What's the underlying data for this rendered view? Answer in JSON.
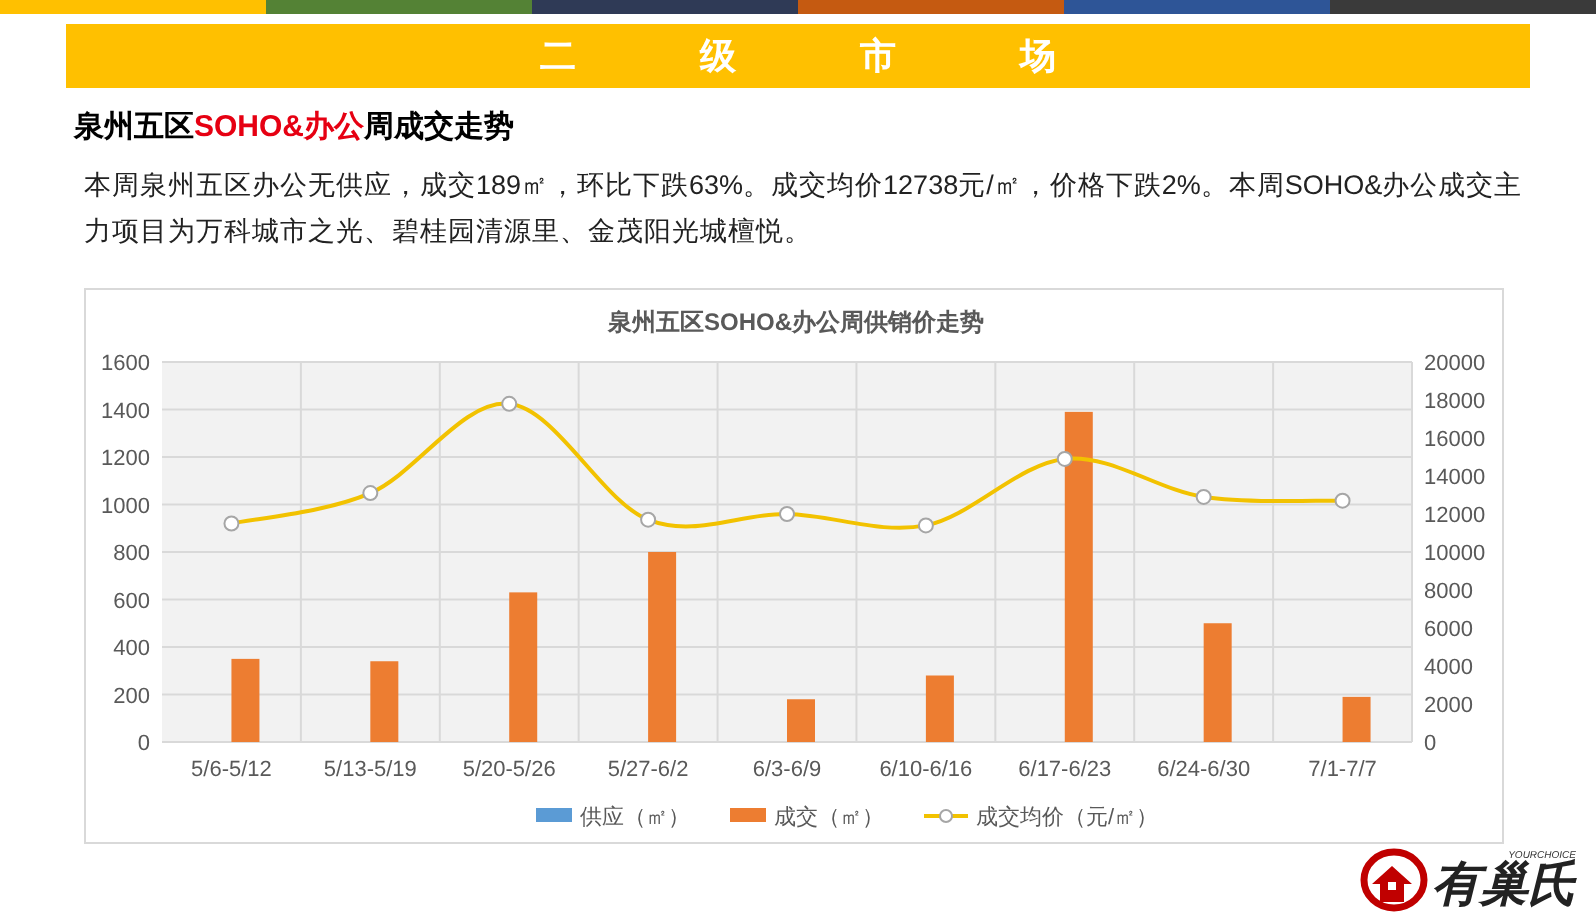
{
  "banner": {
    "title": [
      "二",
      "级",
      "市",
      "场"
    ]
  },
  "heading": {
    "parts": [
      {
        "text": "泉州五区",
        "highlight": false
      },
      {
        "text": "SOHO&办公",
        "highlight": true
      },
      {
        "text": "周成交走势",
        "highlight": false
      }
    ]
  },
  "summary": "本周泉州五区办公无供应，成交189㎡，环比下跌63%。成交均价12738元/㎡，价格下跌2%。本周SOHO&办公成交主力项目为万科城市之光、碧桂园清源里、金茂阳光城檀悦。",
  "chart_data": {
    "type": "bar",
    "title": "泉州五区SOHO&办公周供销价走势",
    "categories": [
      "5/6-5/12",
      "5/13-5/19",
      "5/20-5/26",
      "5/27-6/2",
      "6/3-6/9",
      "6/10-6/16",
      "6/17-6/23",
      "6/24-6/30",
      "7/1-7/7"
    ],
    "series": [
      {
        "name": "供应（㎡）",
        "color": "#5b9bd5",
        "values": [
          null,
          null,
          null,
          null,
          null,
          null,
          null,
          null,
          null
        ]
      },
      {
        "name": "成交（㎡）",
        "color": "#ed7d31",
        "values": [
          350,
          340,
          630,
          800,
          180,
          280,
          1390,
          500,
          190
        ]
      },
      {
        "name": "成交均价（元/㎡）",
        "color": "#f2c200",
        "type": "line",
        "axis": "y2",
        "marker": "circle",
        "values": [
          11500,
          13100,
          17800,
          11700,
          12000,
          11400,
          14900,
          12900,
          12700
        ]
      }
    ],
    "grid": true,
    "legend": "bottom",
    "ylim": [
      0,
      1600
    ],
    "yticks": [
      0,
      200,
      400,
      600,
      800,
      1000,
      1200,
      1400,
      1600
    ],
    "y2lim": [
      0,
      20000
    ],
    "y2ticks": [
      0,
      2000,
      4000,
      6000,
      8000,
      10000,
      12000,
      14000,
      16000,
      18000,
      20000
    ]
  },
  "logo": {
    "tagline": "YOURCHOICE",
    "name": "有巢氏"
  }
}
